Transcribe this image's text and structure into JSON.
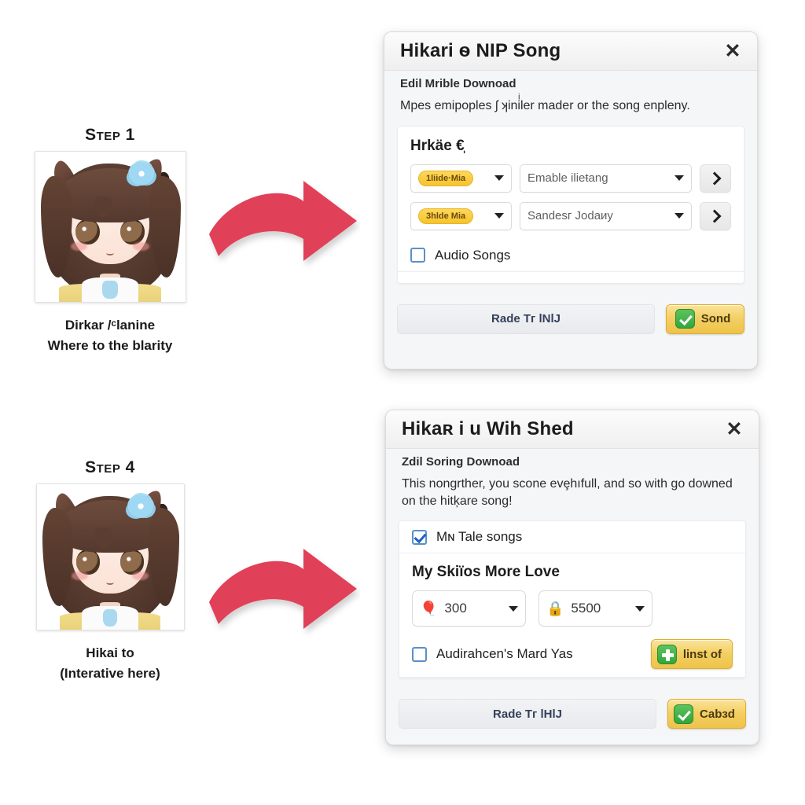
{
  "steps": [
    {
      "label": "Step 1",
      "caption_line1": "Dirkar /ᶜlanine",
      "caption_line2": "Where to the blarity",
      "avatar_name": "chibi-anime-girl-brown-hair-blue-flower"
    },
    {
      "label": "Step 4",
      "caption_line1": "Hikai to",
      "caption_line2": "(Interative here)",
      "avatar_name": "chibi-anime-girl-brown-hair-blue-flower"
    }
  ],
  "arrow": {
    "color": "#e04058",
    "direction": "right"
  },
  "dialogs": [
    {
      "title": "Hikari ѳ ΝIP Song",
      "subtitle": "Edil Mrible Downoad",
      "description": "Mpes emipoples ʃ ʞiniͥler mader or the song enpleny.",
      "close_icon": "✕",
      "panel_heading": "Hrkäe €̩",
      "rows": [
        {
          "badge": "1liide·Mia",
          "select_value": "Emable ilieŧang",
          "chevron_icon": "chevron-right-icon"
        },
        {
          "badge": "3hlde Mia",
          "select_value": "Sandesг Jodaиy",
          "chevron_icon": "chevron-right-icon"
        }
      ],
      "checkbox": {
        "label": "Audio Songs",
        "checked": false
      },
      "footer": {
        "secondary_label": "Rade Tг lNlJ",
        "primary_label": "Sond",
        "primary_icon": "green-check-icon"
      }
    },
    {
      "title": "Hikaʀ i u Wih Shed",
      "subtitle": "Zdil Soring Downoad",
      "description": "This nongrther, you scone evȩhıfull, and so with go downed on the hitķare song!",
      "close_icon": "✕",
      "top_checkbox": {
        "label": "Mɴ Tale songs",
        "checked": true
      },
      "panel_heading": "My Skiïos More Love",
      "counters": [
        {
          "icon": "hot-air-balloon-icon",
          "glyph": "🎈",
          "value": "300"
        },
        {
          "icon": "lock-icon",
          "glyph": "🔒",
          "value": "5500"
        }
      ],
      "option_row": {
        "checkbox": {
          "label": "Audirahcen's Mard Yas",
          "checked": false
        },
        "button_label": "linst of",
        "button_icon": "green-plus-icon"
      },
      "footer": {
        "secondary_label": "Rade Tг lHlJ",
        "primary_label": "Cabзd",
        "primary_icon": "green-check-icon"
      }
    }
  ]
}
